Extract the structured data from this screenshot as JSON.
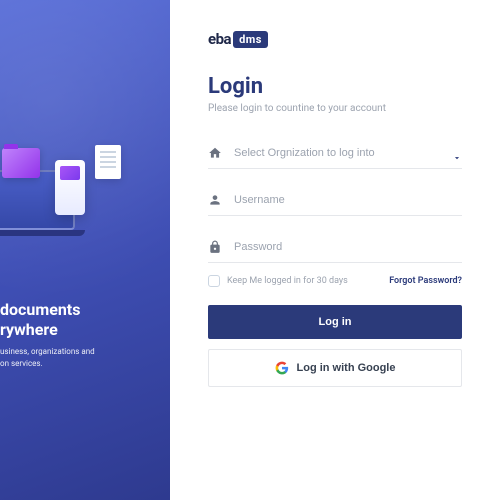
{
  "brand": {
    "part1": "eba",
    "part2": "dms"
  },
  "promo": {
    "title_line1": "documents",
    "title_line2": "rywhere",
    "subtitle_line1": "usiness, organizations and",
    "subtitle_line2": "on services."
  },
  "login": {
    "title": "Login",
    "subtitle": "Please login to countine to your account",
    "org_placeholder": "Select Orgnization to log into",
    "username_placeholder": "Username",
    "password_placeholder": "Password",
    "remember_label": "Keep Me logged in for 30 days",
    "forgot_label": "Forgot Password?",
    "login_button": "Log in",
    "google_button": "Log in with Google"
  },
  "colors": {
    "primary": "#2b3a7a",
    "gradient_start": "#5a6fd8",
    "gradient_end": "#2e3a8f"
  }
}
